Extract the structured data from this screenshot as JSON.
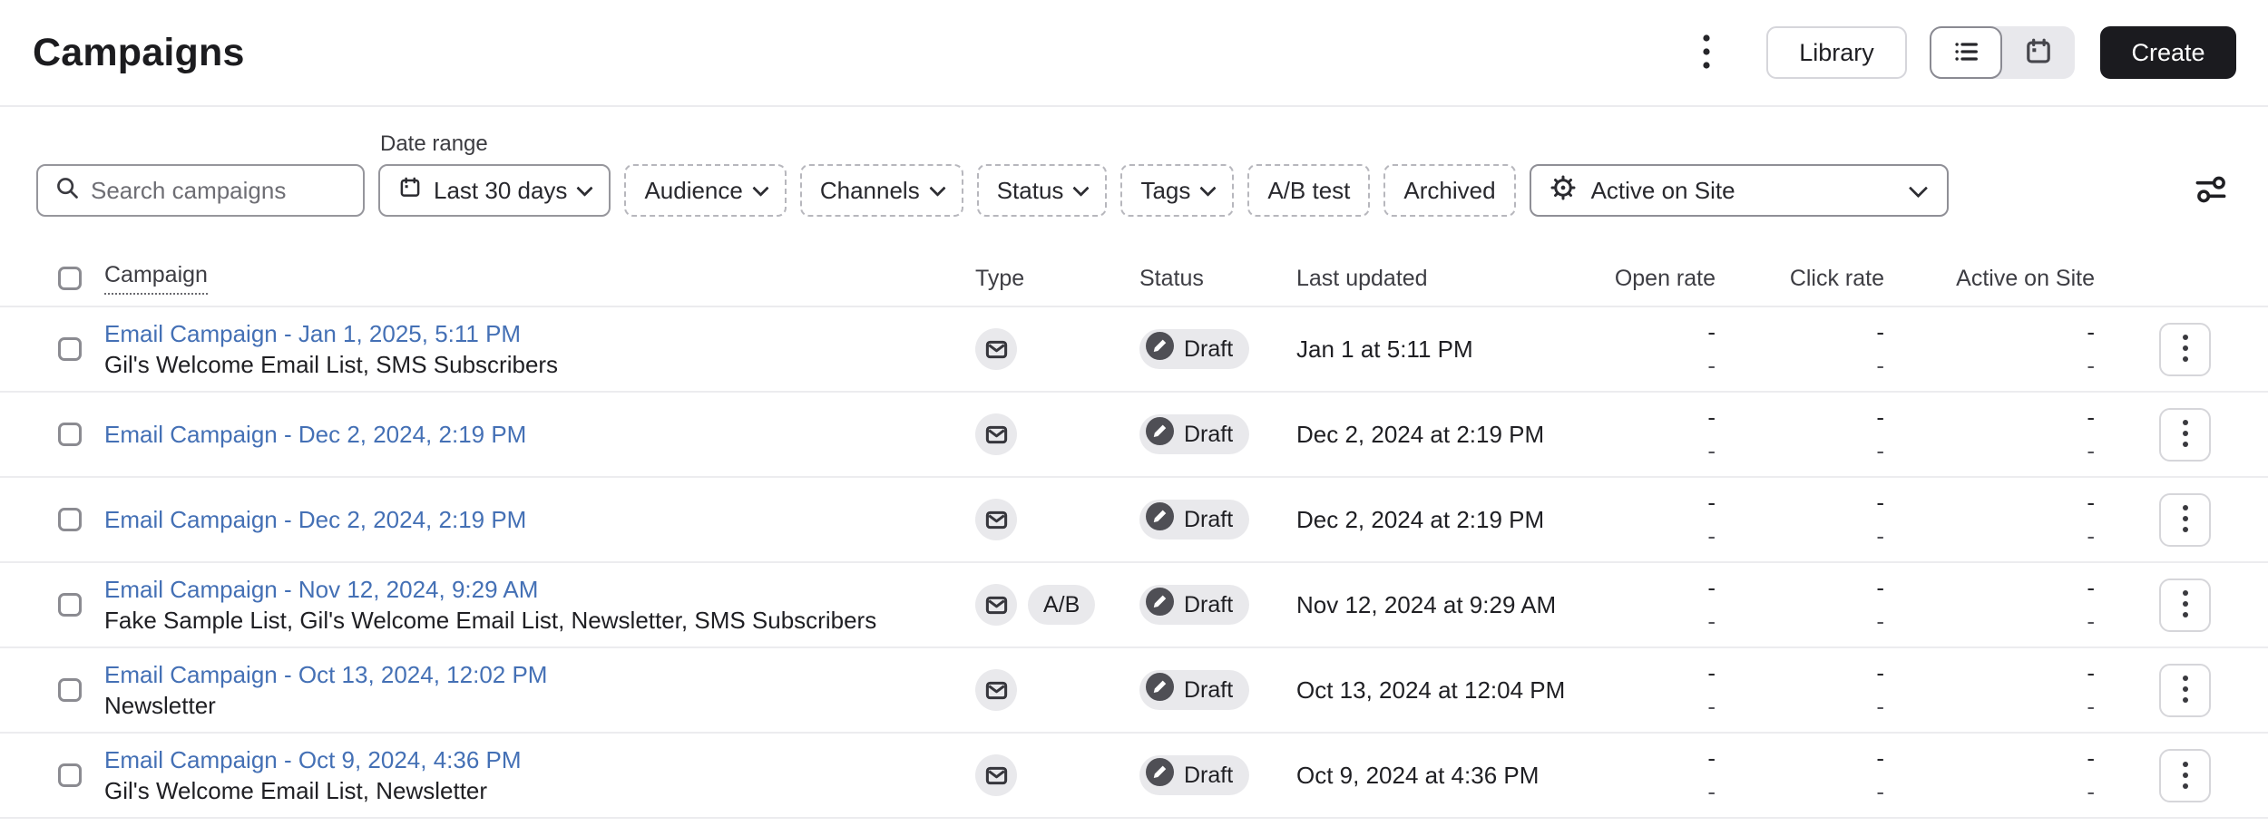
{
  "header": {
    "title": "Campaigns",
    "library_label": "Library",
    "create_label": "Create"
  },
  "filters": {
    "search_placeholder": "Search campaigns",
    "date_range_label": "Date range",
    "date_range_value": "Last 30 days",
    "chips": [
      {
        "label": "Audience"
      },
      {
        "label": "Channels"
      },
      {
        "label": "Status"
      },
      {
        "label": "Tags"
      },
      {
        "label": "A/B test"
      },
      {
        "label": "Archived"
      }
    ],
    "metric_select_value": "Active on Site"
  },
  "icons": [
    "more-vert-icon",
    "list-view-icon",
    "calendar-view-icon",
    "search-icon",
    "calendar-icon",
    "gear-icon",
    "sliders-icon",
    "email-envelope-icon",
    "draft-pencil-icon",
    "row-menu-icon",
    "chevron-down-icon"
  ],
  "colors": {
    "link_blue": "#4470b5",
    "create_button_bg": "#1b1b1f",
    "badge_bg": "#e9e9ec",
    "divider": "#ebebee",
    "draft_icon_circle": "#4f4f55"
  },
  "table": {
    "columns": {
      "campaign": "Campaign",
      "type": "Type",
      "status": "Status",
      "last_updated": "Last updated",
      "open_rate": "Open rate",
      "click_rate": "Click rate",
      "active_on_site": "Active on Site"
    },
    "rows": [
      {
        "title": "Email Campaign - Jan 1, 2025, 5:11 PM",
        "subtitle": "Gil's Welcome Email List, SMS Subscribers",
        "channel": "email",
        "ab_badge": "",
        "status": "Draft",
        "last_updated": "Jan 1 at 5:11 PM",
        "open_rate": [
          "-",
          "-"
        ],
        "click_rate": [
          "-",
          "-"
        ],
        "active_on_site": [
          "-",
          "-"
        ]
      },
      {
        "title": "Email Campaign - Dec 2, 2024, 2:19 PM",
        "subtitle": "",
        "channel": "email",
        "ab_badge": "",
        "status": "Draft",
        "last_updated": "Dec 2, 2024 at 2:19 PM",
        "open_rate": [
          "-",
          "-"
        ],
        "click_rate": [
          "-",
          "-"
        ],
        "active_on_site": [
          "-",
          "-"
        ]
      },
      {
        "title": "Email Campaign - Dec 2, 2024, 2:19 PM",
        "subtitle": "",
        "channel": "email",
        "ab_badge": "",
        "status": "Draft",
        "last_updated": "Dec 2, 2024 at 2:19 PM",
        "open_rate": [
          "-",
          "-"
        ],
        "click_rate": [
          "-",
          "-"
        ],
        "active_on_site": [
          "-",
          "-"
        ]
      },
      {
        "title": "Email Campaign - Nov 12, 2024, 9:29 AM",
        "subtitle": "Fake Sample List, Gil's Welcome Email List, Newsletter, SMS Subscribers",
        "channel": "email",
        "ab_badge": "A/B",
        "status": "Draft",
        "last_updated": "Nov 12, 2024 at 9:29 AM",
        "open_rate": [
          "-",
          "-"
        ],
        "click_rate": [
          "-",
          "-"
        ],
        "active_on_site": [
          "-",
          "-"
        ]
      },
      {
        "title": "Email Campaign - Oct 13, 2024, 12:02 PM",
        "subtitle": "Newsletter",
        "channel": "email",
        "ab_badge": "",
        "status": "Draft",
        "last_updated": "Oct 13, 2024 at 12:04 PM",
        "open_rate": [
          "-",
          "-"
        ],
        "click_rate": [
          "-",
          "-"
        ],
        "active_on_site": [
          "-",
          "-"
        ]
      },
      {
        "title": "Email Campaign - Oct 9, 2024, 4:36 PM",
        "subtitle": "Gil's Welcome Email List, Newsletter",
        "channel": "email",
        "ab_badge": "",
        "status": "Draft",
        "last_updated": "Oct 9, 2024 at 4:36 PM",
        "open_rate": [
          "-",
          "-"
        ],
        "click_rate": [
          "-",
          "-"
        ],
        "active_on_site": [
          "-",
          "-"
        ]
      }
    ]
  }
}
